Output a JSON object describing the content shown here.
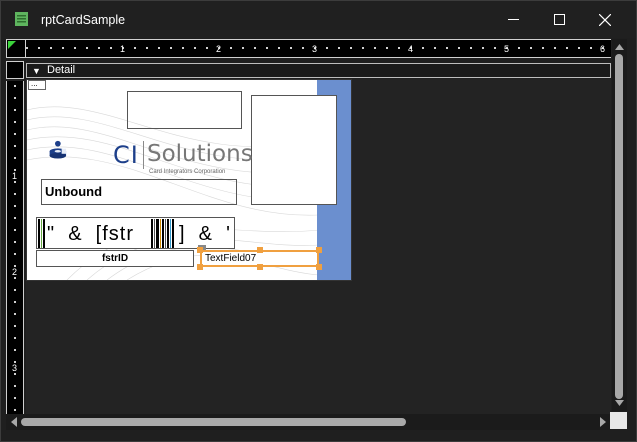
{
  "window": {
    "title": "rptCardSample",
    "controls": [
      "minimize",
      "maximize",
      "close"
    ]
  },
  "ruler": {
    "horizontal_labels": [
      "1",
      "2",
      "3",
      "4",
      "5",
      "6"
    ],
    "vertical_labels": [
      "1",
      "2",
      "3"
    ]
  },
  "section": {
    "label": "Detail"
  },
  "card": {
    "logo_ci": "CI",
    "logo_solutions": "Solutions",
    "logo_tagline": "Card Integrators Corporation",
    "unbound_label": "Unbound",
    "barcode_text": "\"  &  [fstr",
    "barcode_tail": "]  &  '",
    "fstrid_label": "fstrID",
    "textfield_label": "TextField07",
    "dots_tab": "..."
  },
  "colors": {
    "stripe": "#6b8fcf",
    "selection": "#f0a040",
    "logo_blue": "#1d3f8a"
  }
}
